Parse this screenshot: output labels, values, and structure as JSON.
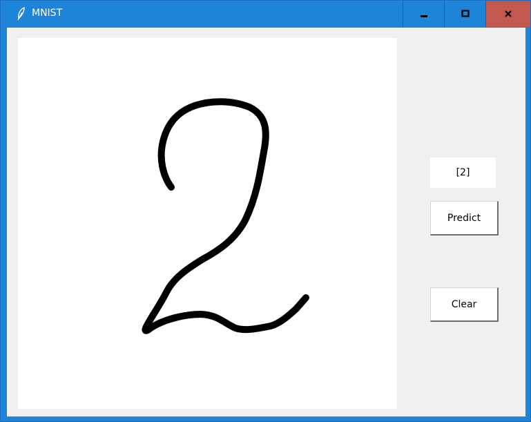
{
  "window": {
    "title": "MNIST",
    "controls": {
      "minimize": "minimize",
      "maximize": "maximize",
      "close": "close"
    },
    "colors": {
      "titlebar": "#1d84d7",
      "close_button": "#c3584f",
      "client_bg": "#f0f0f0"
    }
  },
  "prediction": {
    "result": "[2]"
  },
  "buttons": {
    "predict_label": "Predict",
    "clear_label": "Clear"
  },
  "icons": {
    "app": "feather-icon",
    "minimize": "minimize-icon",
    "maximize": "maximize-icon",
    "close": "close-icon"
  }
}
